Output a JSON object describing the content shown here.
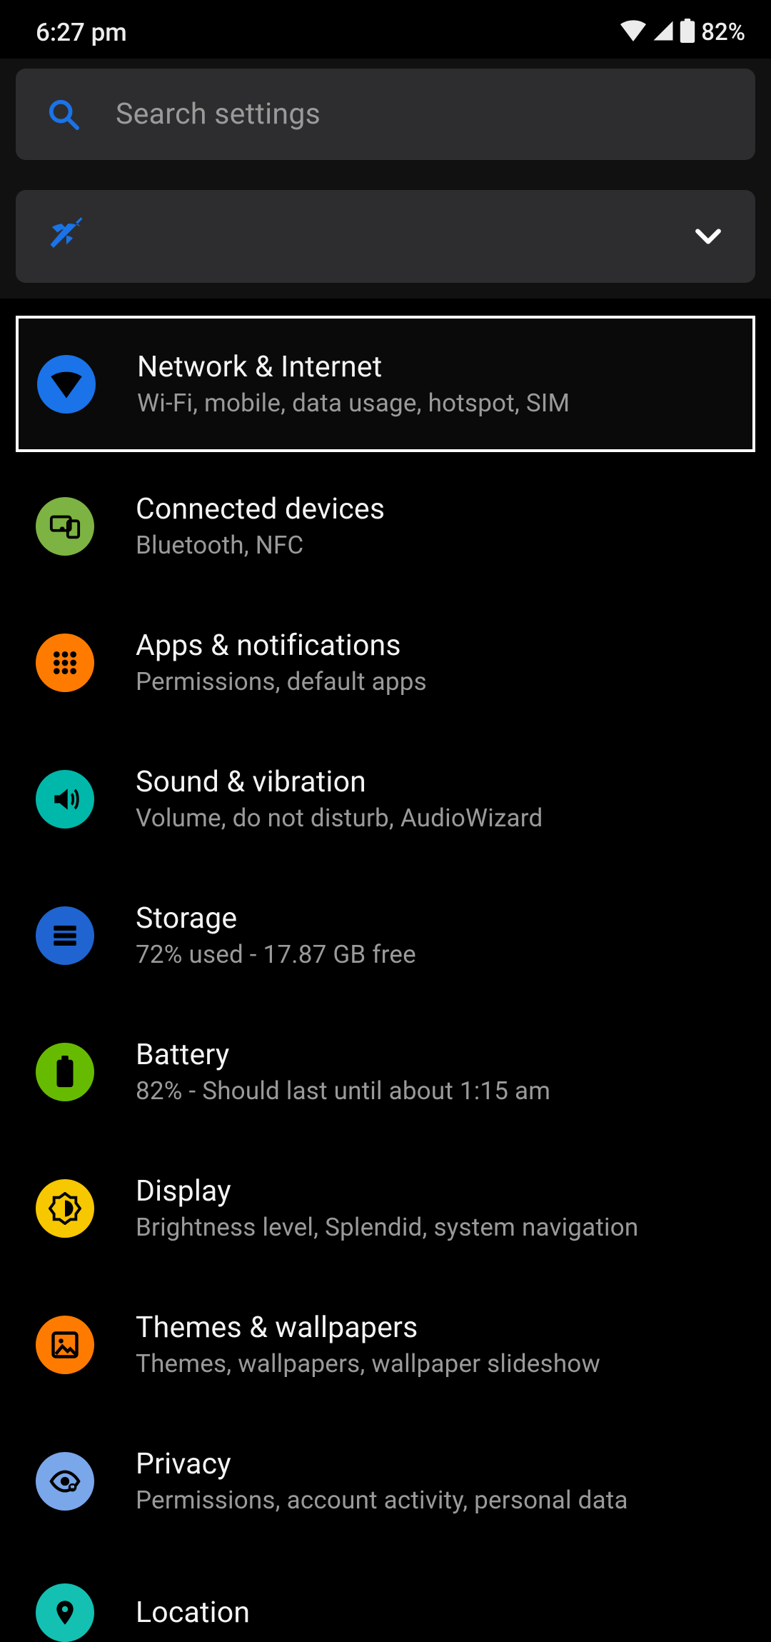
{
  "status": {
    "time": "6:27 pm",
    "battery_text": "82%"
  },
  "search": {
    "placeholder": "Search settings"
  },
  "settings": [
    {
      "title": "Network & Internet",
      "sub": "Wi-Fi, mobile, data usage, hotspot, SIM"
    },
    {
      "title": "Connected devices",
      "sub": "Bluetooth, NFC"
    },
    {
      "title": "Apps & notifications",
      "sub": "Permissions, default apps"
    },
    {
      "title": "Sound & vibration",
      "sub": "Volume, do not disturb, AudioWizard"
    },
    {
      "title": "Storage",
      "sub": "72% used - 17.87 GB free"
    },
    {
      "title": "Battery",
      "sub": "82% - Should last until about 1:15 am"
    },
    {
      "title": "Display",
      "sub": "Brightness level, Splendid, system navigation"
    },
    {
      "title": "Themes & wallpapers",
      "sub": "Themes, wallpapers, wallpaper slideshow"
    },
    {
      "title": "Privacy",
      "sub": "Permissions, account activity, personal data"
    },
    {
      "title": "Location",
      "sub": ""
    }
  ]
}
